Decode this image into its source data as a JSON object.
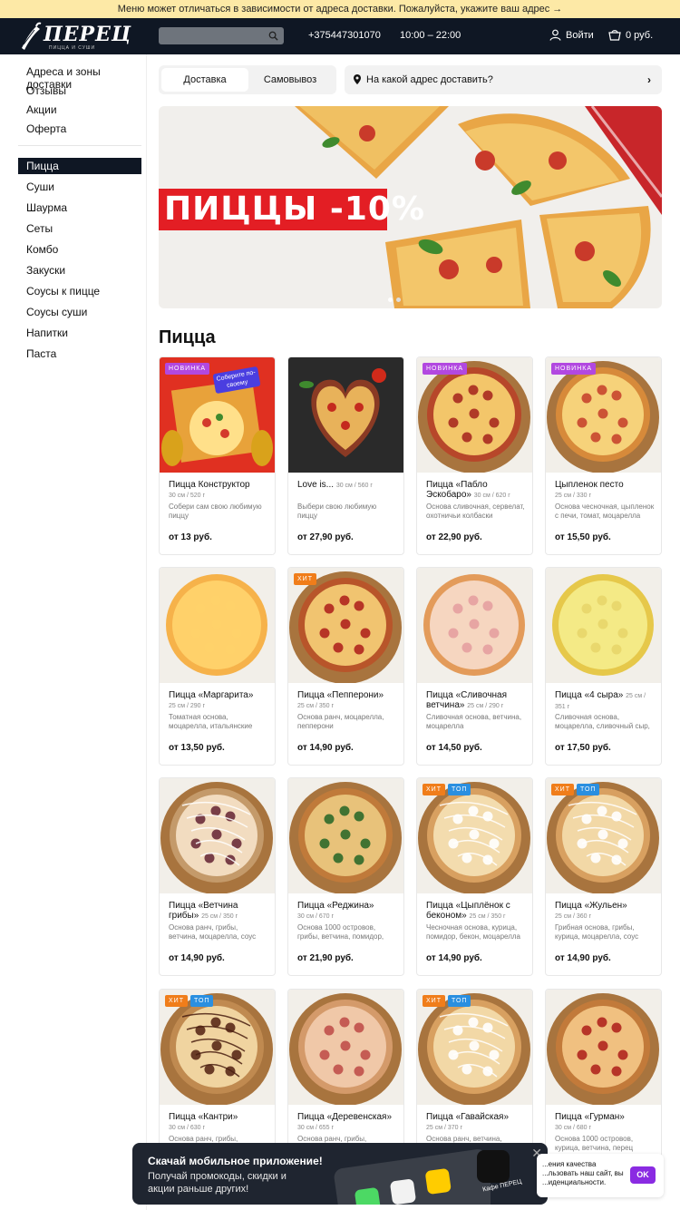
{
  "notice": "Меню может отличаться в зависимости от адреса доставки. Пожалуйста, укажите ваш адрес →",
  "header": {
    "logo_text": "ПЕРЕЦ",
    "logo_sub": "ПИЦЦА И СУШИ",
    "search_placeholder": "",
    "phone": "+375447301070",
    "hours": "10:00 – 22:00",
    "login": "Войти",
    "cart": "0 руб."
  },
  "sidebar": {
    "links": [
      "Адреса и зоны доставки",
      "Отзывы",
      "Акции",
      "Оферта"
    ],
    "categories": [
      "Пицца",
      "Суши",
      "Шаурма",
      "Сеты",
      "Комбо",
      "Закуски",
      "Соусы к пицце",
      "Соусы суши",
      "Напитки",
      "Паста"
    ],
    "active": "Пицца"
  },
  "tabs": [
    "Доставка",
    "Самовывоз"
  ],
  "address_prompt": "На какой адрес доставить?",
  "banner": {
    "text": "ПИЦЦЫ -10%"
  },
  "section_title": "Пицца",
  "products": [
    {
      "name": "Пицца Конструктор",
      "size": "30 см / 520 г",
      "desc": "Собери сам свою любимую пиццу",
      "price": "от 13 руб.",
      "badges": [
        "new"
      ],
      "sticker": "Соберите по-своему"
    },
    {
      "name": "Love is...",
      "size": "30 см / 560 г",
      "desc": "Выбери свою любимую пиццу",
      "price": "от 27,90 руб.",
      "badges": []
    },
    {
      "name": "Пицца «Пабло Эскобаро»",
      "size": "30 см / 620 г",
      "desc": "Основа сливочная, сервелат, охотничьи колбаски",
      "price": "от 22,90 руб.",
      "badges": [
        "new"
      ]
    },
    {
      "name": "Цыпленок песто",
      "size": "25 см / 330 г",
      "desc": "Основа чесночная, цыпленок с печи, томат, моцарелла",
      "price": "от 15,50 руб.",
      "badges": [
        "new"
      ]
    },
    {
      "name": "Пицца «Маргарита»",
      "size": "25 см / 290 г",
      "desc": "Томатная основа, моцарелла, итальянские травы",
      "price": "от 13,50 руб.",
      "badges": []
    },
    {
      "name": "Пицца «Пепперони»",
      "size": "25 см / 350 г",
      "desc": "Основа ранч, моцарелла, пепперони",
      "price": "от 14,90 руб.",
      "badges": [
        "hit"
      ]
    },
    {
      "name": "Пицца «Сливочная ветчина»",
      "size": "25 см / 290 г",
      "desc": "Сливочная основа, ветчина, моцарелла",
      "price": "от 14,50 руб.",
      "badges": []
    },
    {
      "name": "Пицца «4 сыра»",
      "size": "25 см / 351 г",
      "desc": "Сливочная основа, моцарелла, сливочный сыр, пармезан",
      "price": "от 17,50 руб.",
      "badges": []
    },
    {
      "name": "Пицца «Ветчина грибы»",
      "size": "25 см / 350 г",
      "desc": "Основа ранч, грибы, ветчина, моцарелла, соус",
      "price": "от 14,90 руб.",
      "badges": []
    },
    {
      "name": "Пицца «Реджина»",
      "size": "30 см / 670 г",
      "desc": "Основа 1000 островов, грибы, ветчина, помидор, моцарелла",
      "price": "от 21,90 руб.",
      "badges": []
    },
    {
      "name": "Пицца «Цыплёнок с беконом»",
      "size": "25 см / 350 г",
      "desc": "Чесночная основа, курица, помидор, бекон, моцарелла",
      "price": "от 14,90 руб.",
      "badges": [
        "hit",
        "top"
      ]
    },
    {
      "name": "Пицца «Жульен»",
      "size": "25 см / 360 г",
      "desc": "Грибная основа, грибы, курица, моцарелла, соус",
      "price": "от 14,90 руб.",
      "badges": [
        "hit",
        "top"
      ]
    },
    {
      "name": "Пицца «Кантри»",
      "size": "30 см / 630 г",
      "desc": "Основа ранч, грибы,",
      "price": "",
      "badges": [
        "hit",
        "top"
      ]
    },
    {
      "name": "Пицца «Деревенская»",
      "size": "30 см / 655 г",
      "desc": "Основа ранч, грибы,",
      "price": "",
      "badges": []
    },
    {
      "name": "Пицца «Гавайская»",
      "size": "25 см / 370 г",
      "desc": "Основа ранч, ветчина,",
      "price": "",
      "badges": [
        "hit",
        "top"
      ]
    },
    {
      "name": "Пицца «Гурман»",
      "size": "30 см / 680 г",
      "desc": "Основа 1000 островов, курица, ветчина, перец",
      "price": "",
      "badges": []
    }
  ],
  "badge_labels": {
    "new": "НОВИНКА",
    "hit": "ХИТ",
    "top": "ТОП"
  },
  "promo": {
    "title": "Скачай мобильное приложение!",
    "subtitle": "Получай промокоды, скидки и акции раньше других!",
    "app_label": "Кафе ПЕРЕЦ"
  },
  "cookie": {
    "text": "...ения качества ...льзовать наш сайт, вы ...иденциальности.",
    "ok": "OK"
  },
  "colors": {
    "header_bg": "#0f1724",
    "notice_bg": "#fde9a6",
    "banner_red": "#e31e24",
    "cookie_ok": "#8a2be2"
  }
}
